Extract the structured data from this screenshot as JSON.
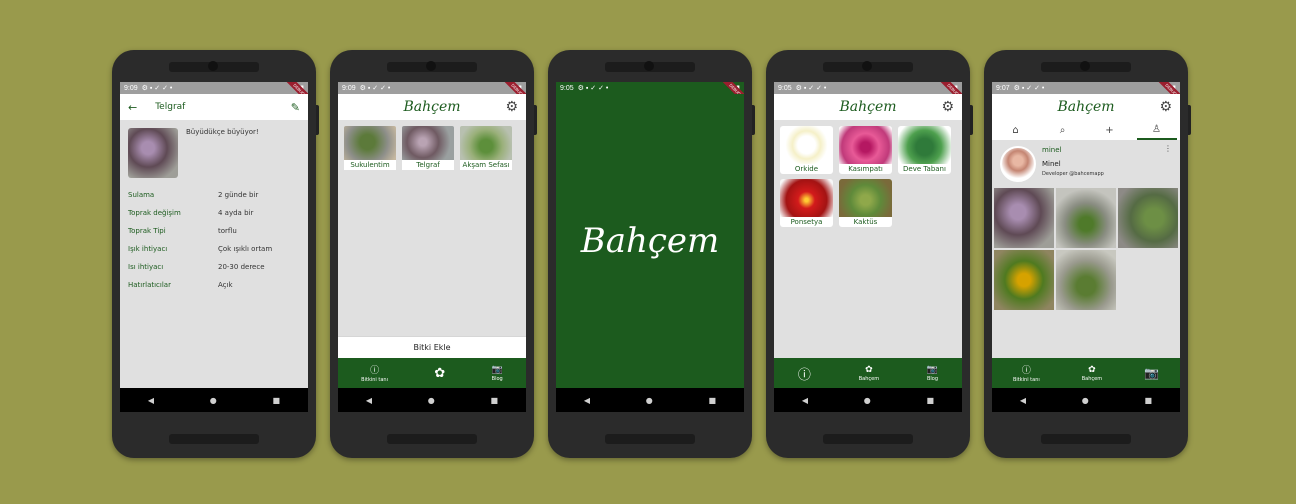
{
  "colors": {
    "background": "#999a4c",
    "brand_green": "#1c5b1e",
    "screen_bg": "#e0e0e0"
  },
  "phone1": {
    "status_time": "9:09",
    "title": "Telgraf",
    "caption": "Büyüdükçe büyüyor!",
    "rows": [
      {
        "key": "Sulama",
        "value": "2 günde bir"
      },
      {
        "key": "Toprak değişim",
        "value": "4 ayda bir"
      },
      {
        "key": "Toprak Tipi",
        "value": "torflu"
      },
      {
        "key": "Işık ihtiyacı",
        "value": "Çok ışıklı ortam"
      },
      {
        "key": "Isı ihtiyacı",
        "value": "20-30 derece"
      },
      {
        "key": "Hatırlatıcılar",
        "value": "Açık"
      }
    ]
  },
  "phone2": {
    "status_time": "9:09",
    "logo": "Bahçem",
    "cards": [
      "Sukulentim",
      "Telgraf",
      "Akşam Sefası"
    ],
    "add_button": "Bitki Ekle",
    "nav": {
      "left": "Bitkini tanı",
      "right": "Blog"
    }
  },
  "phone3": {
    "status_time": "9:05",
    "logo": "Bahçem"
  },
  "phone4": {
    "status_time": "9:05",
    "logo": "Bahçem",
    "tiles": [
      "Orkide",
      "Kasımpatı",
      "Deve Tabanı",
      "Ponsetya",
      "Kaktüs"
    ],
    "nav": {
      "middle": "Bahçem",
      "right": "Blog"
    }
  },
  "phone5": {
    "status_time": "9:07",
    "logo": "Bahçem",
    "username": "minel",
    "fullname": "Minel",
    "bio": "Developer @bahcemapp",
    "nav": {
      "left": "Bitkini tanı",
      "middle": "Bahçem"
    }
  }
}
